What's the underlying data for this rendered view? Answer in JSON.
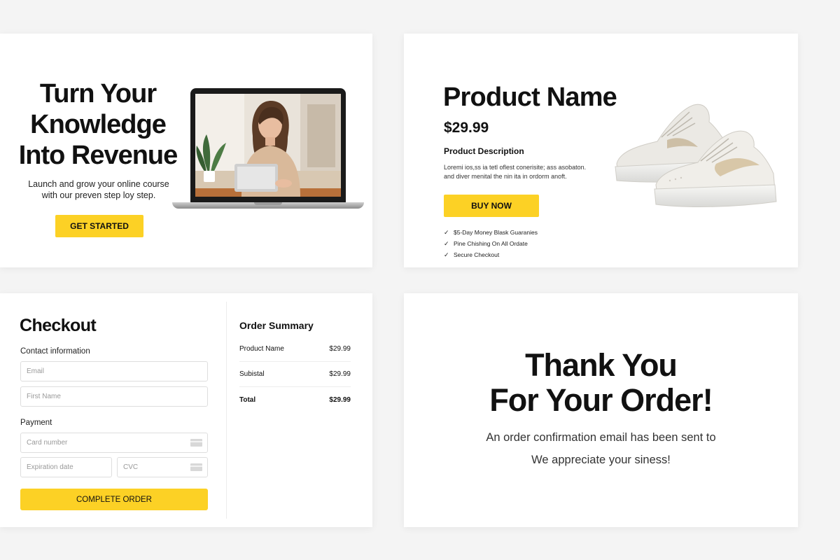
{
  "landing": {
    "title_line1": "Turn Your",
    "title_line2": "Knowledge",
    "title_line3": "Into Revenue",
    "subtitle_line1": "Launch and grow your online course",
    "subtitle_line2": "with our preven step loy step.",
    "cta_label": "GET STARTED"
  },
  "product": {
    "name": "Product Name",
    "price": "$29.99",
    "description_title": "Product Description",
    "description_line1": "Loremi ios,ss ia tetl oflest conerisite; ass asobaton.",
    "description_line2": "and diver menital the nin ita in ordorm anoft.",
    "buy_label": "BUY NOW",
    "features": [
      "$5-Day Money Blask Guaranies",
      "Pine Chishing On All Ordate",
      "Secure Checkout"
    ]
  },
  "checkout": {
    "title": "Checkout",
    "contact_label": "Contact information",
    "email_placeholder": "Email",
    "first_name_placeholder": "First Name",
    "payment_label": "Payment",
    "card_number_placeholder": "Card number",
    "expiration_placeholder": "Expiration date",
    "cvc_placeholder": "CVC",
    "submit_label": "COMPLETE ORDER",
    "summary": {
      "title": "Order Summary",
      "rows": [
        {
          "label": "Product Name",
          "value": "$29.99"
        },
        {
          "label": "Subistal",
          "value": "$29.99"
        },
        {
          "label": "Total",
          "value": "$29.99"
        }
      ]
    }
  },
  "thanks": {
    "title_line1": "Thank You",
    "title_line2": "For Your Order!",
    "message_line1": "An order confirmation email has been sent to",
    "message_line2": "We appreciate your siness!"
  },
  "colors": {
    "accent": "#fcd125",
    "background": "#f4f4f4",
    "card": "#ffffff",
    "text": "#111111"
  },
  "icons": [
    "checkmark-icon",
    "credit-card-icon"
  ]
}
